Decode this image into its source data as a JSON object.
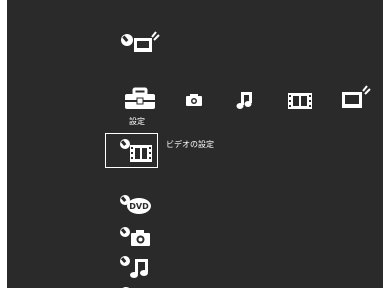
{
  "top_category": {
    "icon": "tv-settings-icon"
  },
  "category_bar": {
    "items": [
      {
        "icon": "toolbox-settings-icon",
        "label": "設定",
        "selected": true
      },
      {
        "icon": "camera-icon"
      },
      {
        "icon": "music-note-icon"
      },
      {
        "icon": "film-icon"
      },
      {
        "icon": "tv-icon"
      }
    ]
  },
  "settings_list": {
    "focused_item": {
      "icon": "video-settings-icon",
      "label": "ビデオの設定"
    },
    "items": [
      {
        "icon": "dvd-settings-icon",
        "badge": "DVD"
      },
      {
        "icon": "photo-settings-icon"
      },
      {
        "icon": "music-settings-icon"
      }
    ]
  },
  "colors": {
    "background": "#2a2a2a",
    "foreground": "#ffffff"
  }
}
